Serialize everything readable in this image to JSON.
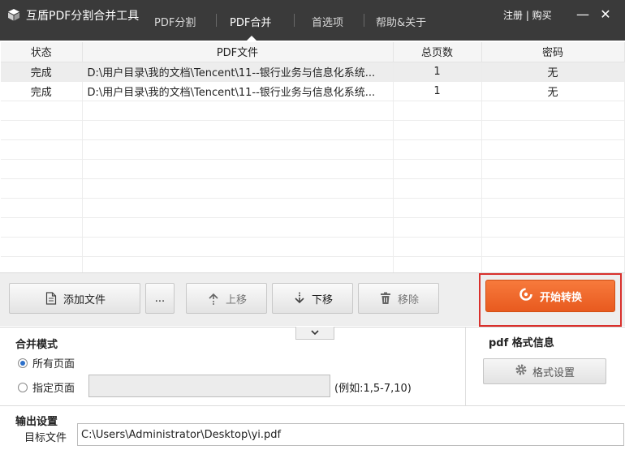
{
  "app": {
    "title": "互盾PDF分割合并工具",
    "icon": "cube-logo-icon"
  },
  "tabs": [
    {
      "label": "PDF分割",
      "active": false
    },
    {
      "label": "PDF合并",
      "active": true
    },
    {
      "label": "首选项",
      "active": false
    },
    {
      "label": "帮助&关于",
      "active": false
    }
  ],
  "account_links": "注册 | 购买",
  "window_controls": {
    "minimize": "—",
    "close": "✕"
  },
  "table": {
    "columns": [
      "状态",
      "PDF文件",
      "总页数",
      "密码"
    ],
    "rows": [
      {
        "status": "完成",
        "file": "D:\\用户目录\\我的文档\\Tencent\\11--银行业务与信息化系统...",
        "pages": "1",
        "password": "无",
        "selected": true
      },
      {
        "status": "完成",
        "file": "D:\\用户目录\\我的文档\\Tencent\\11--银行业务与信息化系统...",
        "pages": "1",
        "password": "无",
        "selected": false
      }
    ]
  },
  "toolbar": {
    "add_file": "添加文件",
    "more": "...",
    "move_up": "上移",
    "move_down": "下移",
    "remove": "移除",
    "start": "开始转换"
  },
  "merge_mode": {
    "title": "合并模式",
    "option_all": "所有页面",
    "option_specific": "指定页面",
    "selected": "所有页面",
    "pages_value": "",
    "pages_hint": "(例如:1,5-7,10)"
  },
  "pdf_format": {
    "title": "pdf 格式信息",
    "settings_button": "格式设置"
  },
  "output": {
    "title": "输出设置",
    "target_label": "目标文件",
    "target_value": "C:\\Users\\Administrator\\Desktop\\yi.pdf"
  },
  "colors": {
    "titlebar": "#3a3a3a",
    "accent_orange": "#ef6a2a",
    "highlight_red": "#d9302c",
    "radio_blue": "#2c6fc9"
  }
}
